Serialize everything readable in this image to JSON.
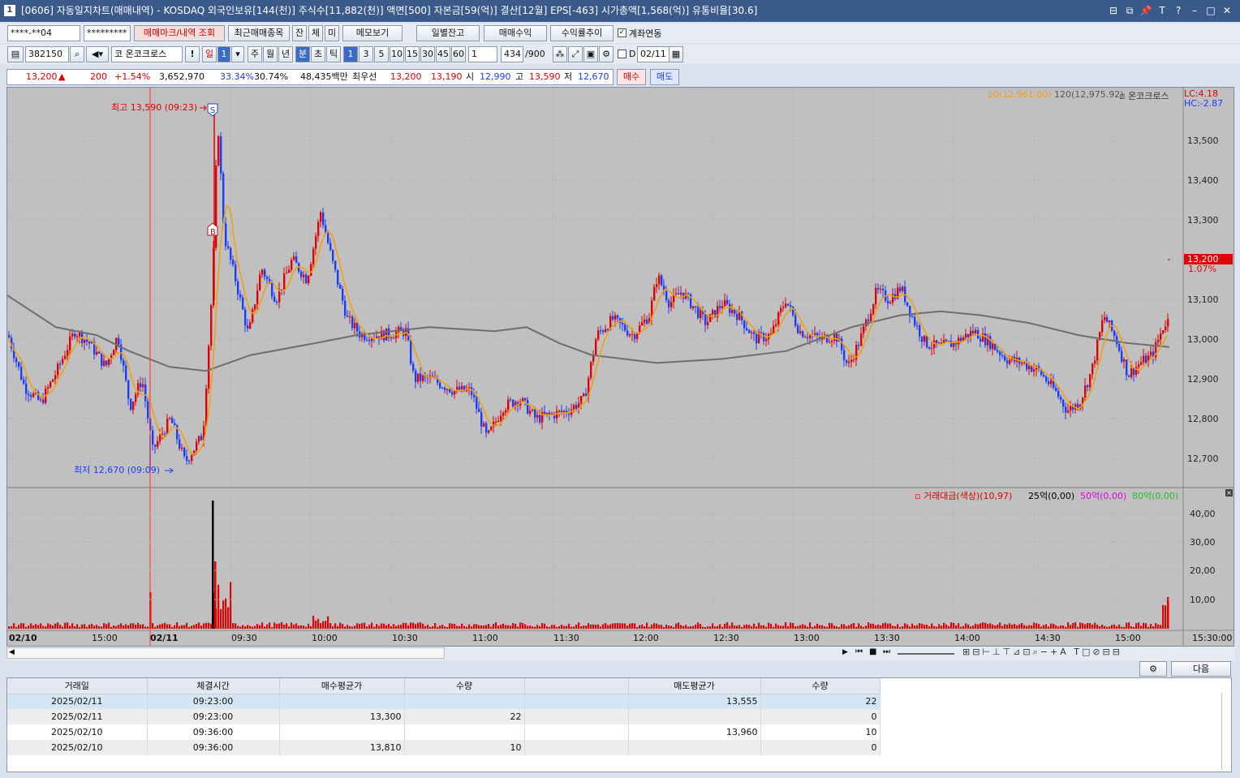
{
  "title": {
    "text": "[0606] 자동일지차트(매매내역) - KOSDAQ 외국인보유[144(천)] 주식수[11,882(천)] 액면[500] 자본금[59(억)] 결산[12월] EPS[-463] 시가총액[1,568(억)] 유통비율[30.6]",
    "icon": "1",
    "controls": [
      "⊟",
      "⧉",
      "📌",
      "T",
      "?",
      "–",
      "□",
      "✕"
    ]
  },
  "toolbar1": {
    "account": "****-**04",
    "password": "*********",
    "buttons": [
      "매매마크/내역 조회",
      "최근매매종목",
      "잔",
      "체",
      "미",
      "메모보기",
      "일별잔고",
      "매매수익",
      "수익률추이"
    ],
    "link_label": "계좌연동",
    "link_checked": true
  },
  "toolbar2": {
    "code": "382150",
    "name": "코 온코크로스",
    "period_btns": [
      "일",
      "주",
      "월",
      "년",
      "분",
      "초",
      "틱"
    ],
    "period_sel": "1",
    "min_btns": [
      "1",
      "3",
      "5",
      "10",
      "15",
      "30",
      "45",
      "60"
    ],
    "cnt": "1",
    "count": "434",
    "count_max": "/900",
    "d_label": "D",
    "date": "02/11"
  },
  "quote": {
    "price": "13,200",
    "arrow": "▲",
    "change": "200",
    "rate": "+1.54%",
    "volume": "3,652,970",
    "r1": "33.34%",
    "r2": "30.74%",
    "amount": "48,435백만",
    "best_label": "최우선",
    "best_ask": "13,200",
    "best_bid": "13,190",
    "open_label": "시",
    "open": "12,990",
    "high_label": "고",
    "high": "13,590",
    "low_label": "저",
    "low": "12,670",
    "buy": "매수",
    "sell": "매도"
  },
  "chart": {
    "legend": {
      "ma20": "20(12,961.00)",
      "ma120": "120(12,975.92)",
      "name": "온코크로스"
    },
    "lc": "LC:4.18",
    "hc": "HC:-2.87",
    "high_note": "최고 13,590 (09:23)",
    "low_note": "최저 12,670 (09:09)",
    "cur_price": "13,200",
    "cur_pct": "1.07%",
    "price_ticks": [
      "13,500",
      "13,400",
      "13,300",
      "13,200",
      "13,100",
      "13,000",
      "12,900",
      "12,800",
      "12,700"
    ],
    "vol_legend": {
      "main": "거래대금(색상)(10,97)",
      "a": "25억(0,00)",
      "b": "50억(0,00)",
      "c": "80억(0,00)"
    },
    "vol_ticks": [
      "40,00",
      "30,00",
      "20,00",
      "10,00"
    ],
    "time_ticks": [
      "02/10",
      "15:00",
      "02/11",
      "09:30",
      "10:00",
      "10:30",
      "11:00",
      "11:30",
      "12:00",
      "12:30",
      "13:00",
      "13:30",
      "14:00",
      "14:30",
      "15:00",
      "15:30:00"
    ],
    "mark_s": "S",
    "mark_b": "B",
    "colors": {
      "up": "#e00000",
      "down": "#1a3cff",
      "ma20": "#f0a010",
      "ma120": "#6e6e6e"
    }
  },
  "chart_data": {
    "type": "candlestick",
    "series": [
      {
        "name": "20",
        "value": 12961.0
      },
      {
        "name": "120",
        "value": 12975.92
      }
    ],
    "y_range": [
      12650,
      13650
    ],
    "high": {
      "value": 13590,
      "time": "09:23"
    },
    "low": {
      "value": 12670,
      "time": "09:09"
    },
    "last": 13200
  },
  "footer": {
    "next": "다음",
    "settings": "⚙"
  },
  "trades": {
    "headers": [
      "거래일",
      "체결시간",
      "매수평균가",
      "수량",
      "",
      "매도평균가",
      "수량"
    ],
    "rows": [
      [
        "2025/02/11",
        "09:23:00",
        "",
        "",
        "",
        "13,555",
        "22"
      ],
      [
        "2025/02/11",
        "09:23:00",
        "13,300",
        "22",
        "",
        "",
        "0"
      ],
      [
        "2025/02/10",
        "09:36:00",
        "",
        "",
        "",
        "13,960",
        "10"
      ],
      [
        "2025/02/10",
        "09:36:00",
        "13,810",
        "10",
        "",
        "",
        "0"
      ]
    ]
  }
}
